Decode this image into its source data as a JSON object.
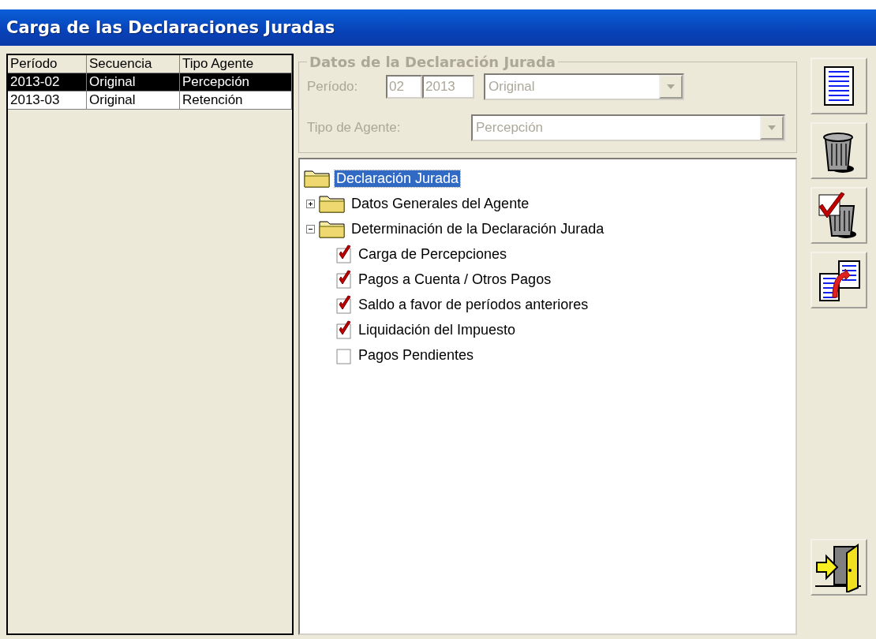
{
  "window": {
    "title": "Carga de las Declaraciones Juradas"
  },
  "table": {
    "columns": [
      "Período",
      "Secuencia",
      "Tipo Agente"
    ],
    "rows": [
      {
        "cells": [
          "2013-02",
          "Original",
          "Percepción"
        ],
        "selected": true
      },
      {
        "cells": [
          "2013-03",
          "Original",
          "Retención"
        ],
        "selected": false
      }
    ]
  },
  "form": {
    "title": "Datos de la Declaración Jurada",
    "disabled": true,
    "period_label": "Período:",
    "month": "02",
    "year": "2013",
    "sequence": "Original",
    "agent_label": "Tipo de Agente:",
    "agent_type": "Percepción"
  },
  "tree": [
    {
      "label": "Declaración Jurada",
      "selected": true,
      "children": [
        {
          "label": "Datos Generales del Agente",
          "selected": false,
          "expanded": false
        },
        {
          "label": "Determinación de la Declaración Jurada",
          "selected": false,
          "expanded": true,
          "children": [
            {
              "label": "Carga de Percepciones",
              "checked": true
            },
            {
              "label": "Pagos a Cuenta / Otros Pagos",
              "checked": true
            },
            {
              "label": "Saldo a favor de períodos anteriores",
              "checked": true
            },
            {
              "label": "Liquidación del Impuesto",
              "checked": true
            },
            {
              "label": "Pagos Pendientes",
              "checked": false
            }
          ]
        }
      ]
    }
  ],
  "toolbar": [
    {
      "kind": "document"
    },
    {
      "kind": "trash"
    },
    {
      "kind": "trash-check"
    },
    {
      "kind": "copy"
    }
  ],
  "exit_button": {
    "kind": "exit"
  }
}
